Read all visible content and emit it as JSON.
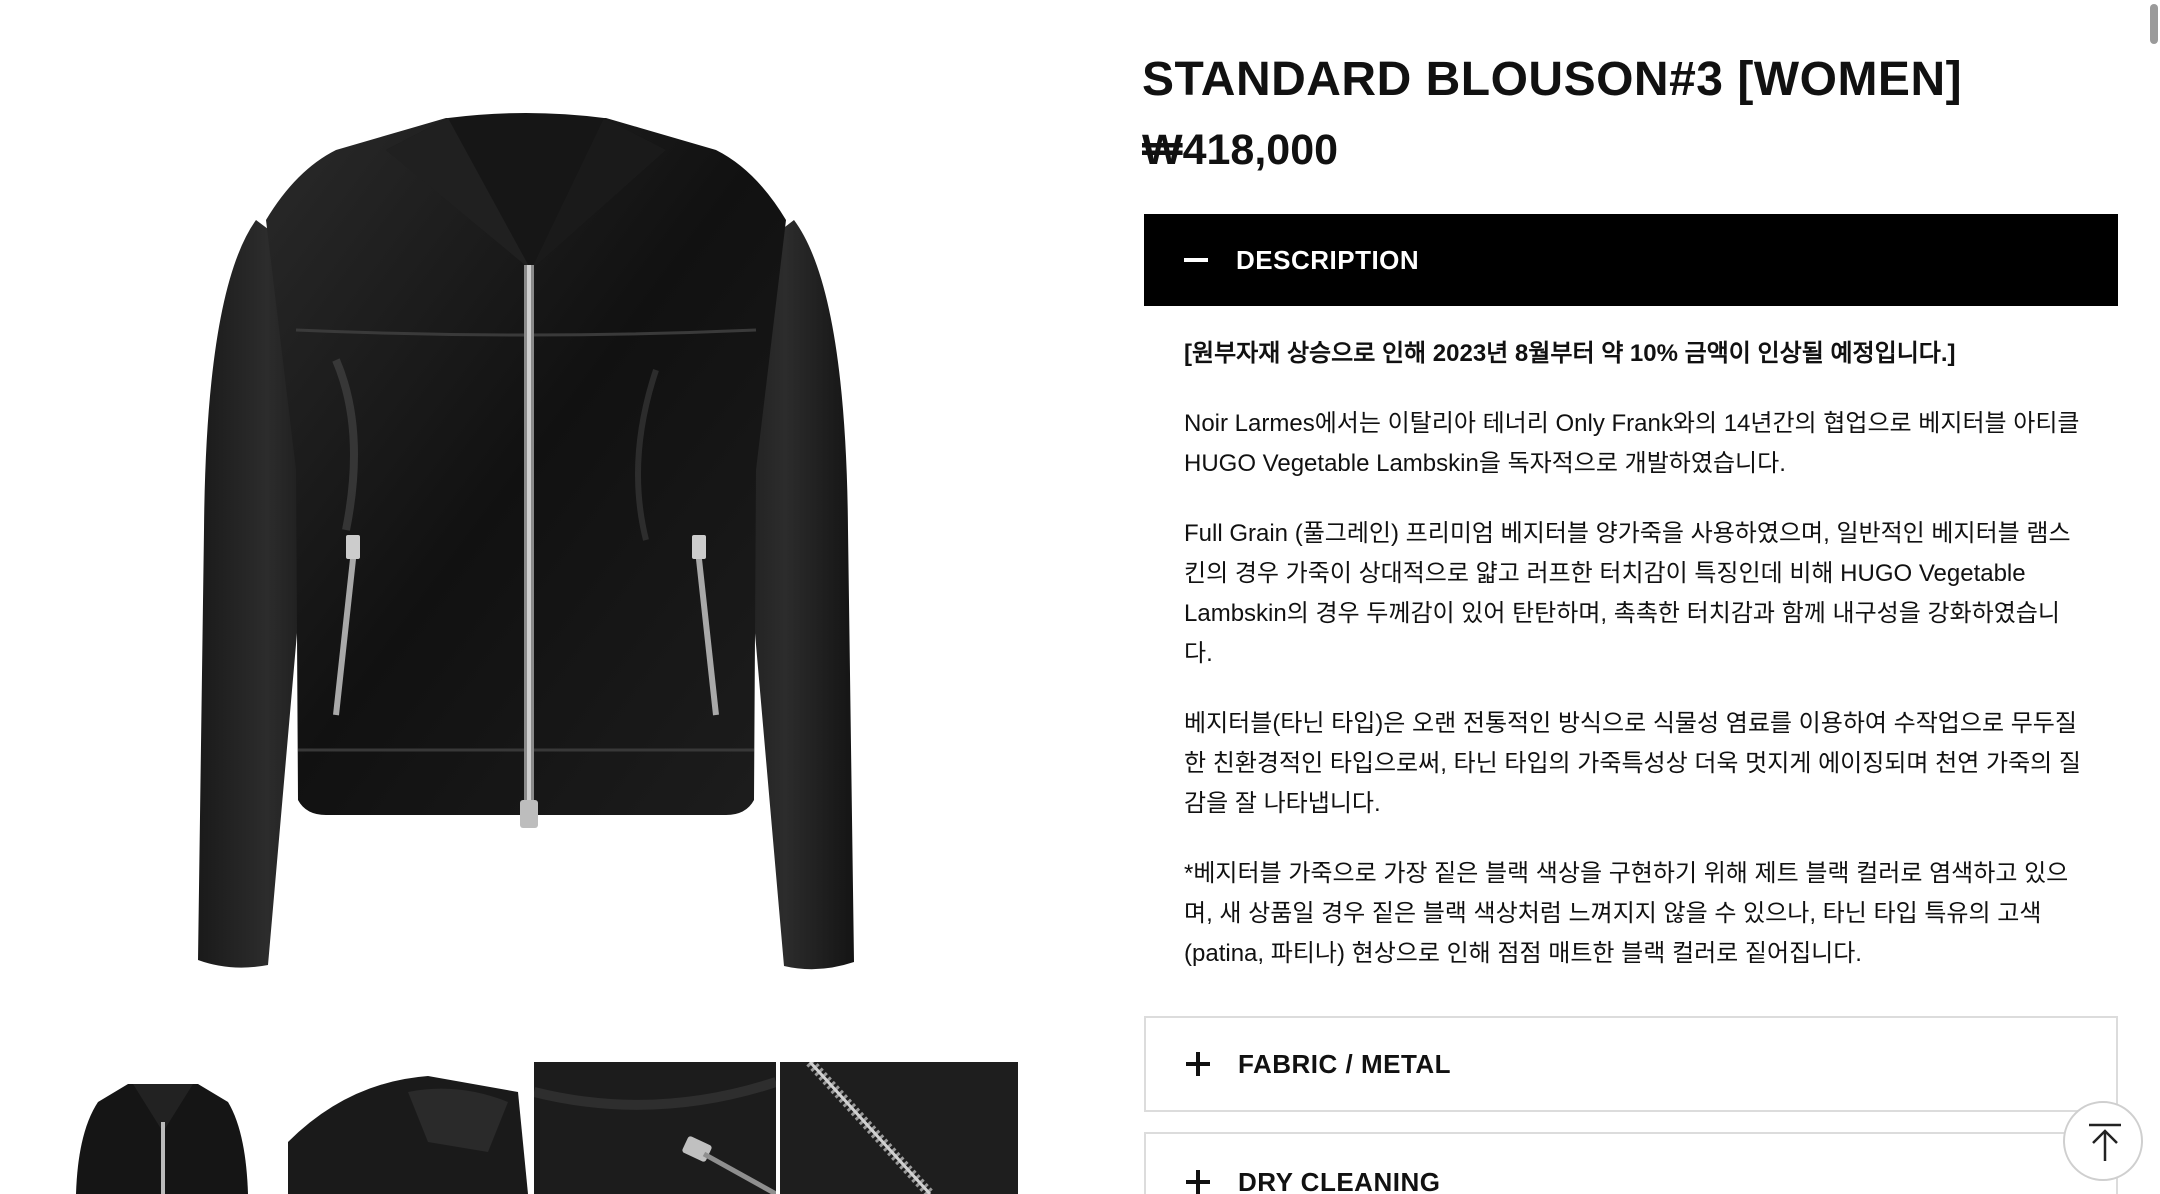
{
  "product": {
    "title": "STANDARD BLOUSON#3 [WOMEN]",
    "price": "₩418,000"
  },
  "gallery": {
    "main_image": "black-leather-blouson-jacket",
    "thumbnails": [
      "jacket-front-thumbnail",
      "jacket-collar-thumbnail",
      "jacket-pocket-zipper-thumbnail",
      "jacket-front-zipper-thumbnail"
    ]
  },
  "accordion": {
    "description": {
      "label": "DESCRIPTION",
      "icon": "minus-icon",
      "expanded": true,
      "paragraphs": [
        "[원부자재 상승으로 인해 2023년 8월부터 약 10% 금액이 인상될 예정입니다.]",
        "Noir Larmes에서는 이탈리아 테너리 Only Frank와의 14년간의 협업으로 베지터블 아티클 HUGO Vegetable Lambskin을 독자적으로 개발하였습니다.",
        "Full Grain (풀그레인) 프리미엄 베지터블 양가죽을 사용하였으며, 일반적인 베지터블 램스킨의 경우 가죽이 상대적으로 얇고 러프한 터치감이 특징인데 비해 HUGO Vegetable Lambskin의 경우 두께감이 있어 탄탄하며, 촉촉한 터치감과 함께 내구성을 강화하였습니다.",
        "베지터블(타닌 타입)은 오랜 전통적인 방식으로 식물성 염료를 이용하여 수작업으로 무두질한 친환경적인 타입으로써, 타닌 타입의 가죽특성상 더욱 멋지게 에이징되며 천연 가죽의 질감을 잘 나타냅니다.",
        "*베지터블 가죽으로 가장 짙은 블랙 색상을 구현하기 위해 제트 블랙 컬러로 염색하고 있으며, 새 상품일 경우 짙은 블랙 색상처럼 느껴지지 않을 수 있으나, 타닌 타입 특유의 고색(patina, 파티나) 현상으로 인해 점점 매트한 블랙 컬러로 짙어집니다."
      ]
    },
    "fabric": {
      "label": "FABRIC / METAL",
      "icon": "plus-icon",
      "expanded": false
    },
    "dry_cleaning": {
      "label": "DRY CLEANING",
      "icon": "plus-icon",
      "expanded": false
    }
  },
  "floating": {
    "scroll_top_icon": "arrow-up-to-top-icon"
  },
  "colors": {
    "accent": "#000000",
    "text": "#111111",
    "border": "#dcdcdc",
    "background": "#ffffff"
  }
}
